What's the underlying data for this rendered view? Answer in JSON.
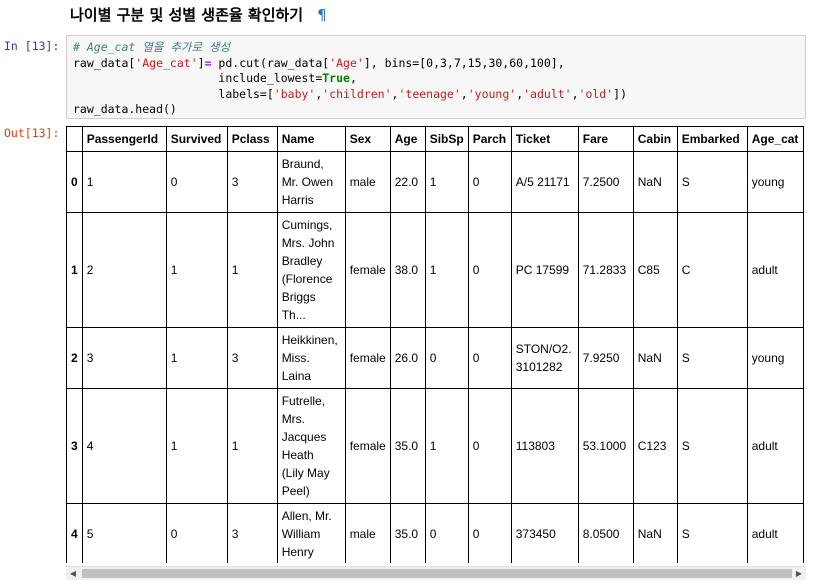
{
  "heading": {
    "text": "나이별 구분 및 성별 생존율 확인하기",
    "pilcrow": "¶"
  },
  "in_prompt": "In [13]:",
  "out_prompt": "Out[13]:",
  "code": {
    "comment": "# Age_cat 열을 추가로 생성",
    "line2_a": "raw_data[",
    "line2_s1": "'Age_cat'",
    "line2_b": "]",
    "line2_eq": "=",
    "line2_c": " pd.cut(raw_data[",
    "line2_s2": "'Age'",
    "line2_d": "], bins=[0,3,7,15,30,60,100],",
    "line3_a": "                     include_lowest=",
    "line3_kw": "True",
    "line3_b": ",",
    "line4_a": "                     labels=[",
    "labels": [
      "'baby'",
      "'children'",
      "'teenage'",
      "'young'",
      "'adult'",
      "'old'"
    ],
    "line4_b": "])",
    "line5": "raw_data.head()"
  },
  "table": {
    "columns": [
      "",
      "PassengerId",
      "Survived",
      "Pclass",
      "Name",
      "Sex",
      "Age",
      "SibSp",
      "Parch",
      "Ticket",
      "Fare",
      "Cabin",
      "Embarked",
      "Age_cat"
    ],
    "rows": [
      [
        "0",
        "1",
        "0",
        "3",
        [
          "Braund,",
          "Mr. Owen",
          "Harris"
        ],
        "male",
        "22.0",
        "1",
        "0",
        "A/5 21171",
        "7.2500",
        "NaN",
        "S",
        "young"
      ],
      [
        "1",
        "2",
        "1",
        "1",
        [
          "Cumings,",
          "Mrs. John",
          "Bradley",
          "(Florence",
          "Briggs",
          "Th..."
        ],
        "female",
        "38.0",
        "1",
        "0",
        "PC 17599",
        "71.2833",
        "C85",
        "C",
        "adult"
      ],
      [
        "2",
        "3",
        "1",
        "3",
        [
          "Heikkinen,",
          "Miss.",
          "Laina"
        ],
        "female",
        "26.0",
        "0",
        "0",
        [
          "STON/O2.",
          "3101282"
        ],
        "7.9250",
        "NaN",
        "S",
        "young"
      ],
      [
        "3",
        "4",
        "1",
        "1",
        [
          "Futrelle,",
          "Mrs.",
          "Jacques",
          "Heath",
          "(Lily May",
          "Peel)"
        ],
        "female",
        "35.0",
        "1",
        "0",
        "113803",
        "53.1000",
        "C123",
        "S",
        "adult"
      ],
      [
        "4",
        "5",
        "0",
        "3",
        [
          "Allen, Mr.",
          "William",
          "Henry"
        ],
        "male",
        "35.0",
        "0",
        "0",
        "373450",
        "8.0500",
        "NaN",
        "S",
        "adult"
      ]
    ]
  },
  "scrollbar": {
    "left_arrow": "◀",
    "right_arrow": "▶"
  }
}
